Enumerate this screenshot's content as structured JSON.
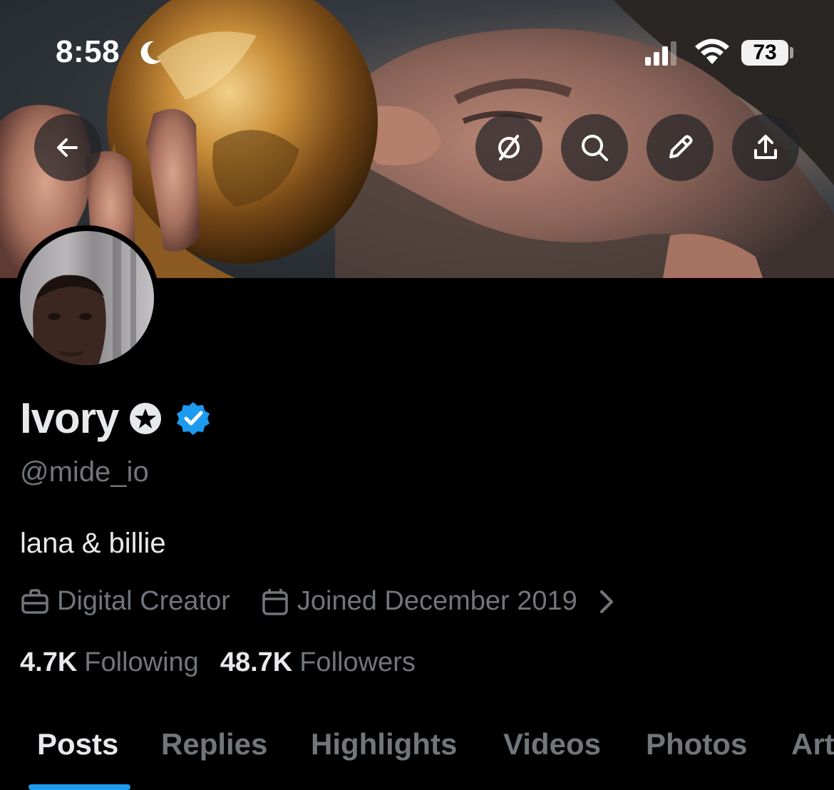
{
  "status_bar": {
    "time": "8:58",
    "battery": "73",
    "icons": [
      "moon-icon",
      "cellular-signal-icon",
      "wifi-icon",
      "battery-icon"
    ]
  },
  "header": {
    "buttons": [
      "back-arrow-icon",
      "grok-icon",
      "search-icon",
      "edit-pencil-icon",
      "share-icon"
    ]
  },
  "profile": {
    "name": "Ivory",
    "handle": "@mide_io",
    "bio": "lana & billie",
    "category": "Digital Creator",
    "joined": "Joined December 2019",
    "following_count": "4.7K",
    "following_label": "Following",
    "followers_count": "48.7K",
    "followers_label": "Followers",
    "verified_color": "#1d9bf0"
  },
  "tabs": [
    {
      "label": "Posts",
      "active": true
    },
    {
      "label": "Replies",
      "active": false
    },
    {
      "label": "Highlights",
      "active": false
    },
    {
      "label": "Videos",
      "active": false
    },
    {
      "label": "Photos",
      "active": false
    },
    {
      "label": "Art",
      "active": false
    }
  ],
  "colors": {
    "accent": "#1d9bf0",
    "text_primary": "#e7e9ea",
    "text_secondary": "#71767b",
    "background": "#000000"
  }
}
